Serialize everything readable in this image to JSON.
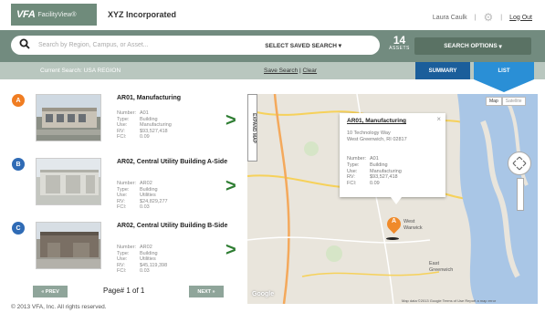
{
  "header": {
    "brand_main": "VFA",
    "brand_sub": "FacilityView®",
    "company": "XYZ Incorporated",
    "user": "Laura Caulk",
    "logout": "Log Out",
    "icons": [
      "gear-icon"
    ]
  },
  "search": {
    "placeholder": "Search by Region, Campus, or Asset...",
    "saved_search": "SELECT SAVED SEARCH",
    "assets_count": "14",
    "assets_label": "ASSETS",
    "options_label": "SEARCH OPTIONS"
  },
  "subbar": {
    "current_search": "Current Search: USA REGION",
    "save_search": "Save Search",
    "clear": "Clear",
    "tab_summary": "SUMMARY",
    "tab_list": "LIST"
  },
  "labels": {
    "number": "Number:",
    "type": "Type:",
    "use": "Use:",
    "rv": "RV:",
    "fci": "FCI:"
  },
  "items": [
    {
      "marker": "A",
      "marker_color": "#f07d22",
      "name": "AR01, Manufacturing",
      "number": "A01",
      "type": "Building",
      "use": "Manufacturing",
      "rv": "$93,527,418",
      "fci": "0.09"
    },
    {
      "marker": "B",
      "marker_color": "#2f6bb5",
      "name": "AR02, Central Utility Building A-Side",
      "number": "AR02",
      "type": "Building",
      "use": "Utilities",
      "rv": "$24,829,277",
      "fci": "0.03"
    },
    {
      "marker": "C",
      "marker_color": "#2f6bb5",
      "name": "AR02, Central Utility Building B-Side",
      "number": "AR02",
      "type": "Building",
      "use": "Utilities",
      "rv": "$45,119,398",
      "fci": "0.03"
    }
  ],
  "map": {
    "expand_label": "EXPAND MAP",
    "map_button": "Map",
    "satellite_button": "Satellite",
    "pin_letter": "A",
    "popup": {
      "title": "AR01, Manufacturing",
      "address1": "10 Technology Way",
      "address2": "West Greenwich, RI 02817",
      "number": "A01",
      "type": "Building",
      "use": "Manufacturing",
      "rv": "$93,527,418",
      "fci": "0.09"
    },
    "place_west": "West",
    "place_warwick": "Warwick",
    "place_east": "East",
    "place_greenwich": "Greenwich",
    "google": "Google",
    "attribution": "Map data ©2013 Google   Terms of Use   Report a map error"
  },
  "pagination": {
    "prev": "« PREV",
    "page": "Page# 1 of 1",
    "next": "NEXT »"
  },
  "footer": "© 2013 VFA, Inc. All rights reserved."
}
